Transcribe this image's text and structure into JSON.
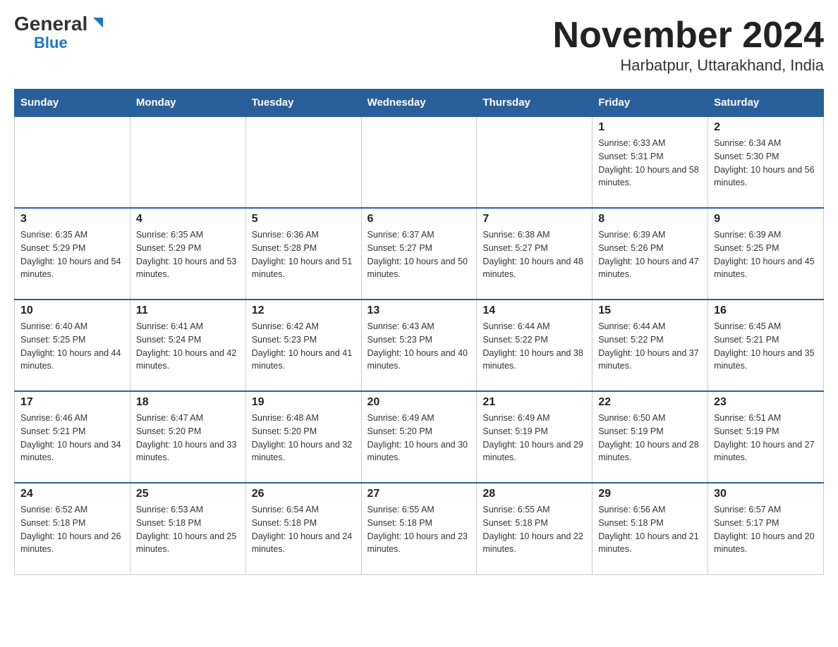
{
  "header": {
    "logo_general": "General",
    "logo_blue": "Blue",
    "month_title": "November 2024",
    "location": "Harbatpur, Uttarakhand, India"
  },
  "days_of_week": [
    "Sunday",
    "Monday",
    "Tuesday",
    "Wednesday",
    "Thursday",
    "Friday",
    "Saturday"
  ],
  "weeks": [
    [
      {
        "day": "",
        "info": ""
      },
      {
        "day": "",
        "info": ""
      },
      {
        "day": "",
        "info": ""
      },
      {
        "day": "",
        "info": ""
      },
      {
        "day": "",
        "info": ""
      },
      {
        "day": "1",
        "info": "Sunrise: 6:33 AM\nSunset: 5:31 PM\nDaylight: 10 hours and 58 minutes."
      },
      {
        "day": "2",
        "info": "Sunrise: 6:34 AM\nSunset: 5:30 PM\nDaylight: 10 hours and 56 minutes."
      }
    ],
    [
      {
        "day": "3",
        "info": "Sunrise: 6:35 AM\nSunset: 5:29 PM\nDaylight: 10 hours and 54 minutes."
      },
      {
        "day": "4",
        "info": "Sunrise: 6:35 AM\nSunset: 5:29 PM\nDaylight: 10 hours and 53 minutes."
      },
      {
        "day": "5",
        "info": "Sunrise: 6:36 AM\nSunset: 5:28 PM\nDaylight: 10 hours and 51 minutes."
      },
      {
        "day": "6",
        "info": "Sunrise: 6:37 AM\nSunset: 5:27 PM\nDaylight: 10 hours and 50 minutes."
      },
      {
        "day": "7",
        "info": "Sunrise: 6:38 AM\nSunset: 5:27 PM\nDaylight: 10 hours and 48 minutes."
      },
      {
        "day": "8",
        "info": "Sunrise: 6:39 AM\nSunset: 5:26 PM\nDaylight: 10 hours and 47 minutes."
      },
      {
        "day": "9",
        "info": "Sunrise: 6:39 AM\nSunset: 5:25 PM\nDaylight: 10 hours and 45 minutes."
      }
    ],
    [
      {
        "day": "10",
        "info": "Sunrise: 6:40 AM\nSunset: 5:25 PM\nDaylight: 10 hours and 44 minutes."
      },
      {
        "day": "11",
        "info": "Sunrise: 6:41 AM\nSunset: 5:24 PM\nDaylight: 10 hours and 42 minutes."
      },
      {
        "day": "12",
        "info": "Sunrise: 6:42 AM\nSunset: 5:23 PM\nDaylight: 10 hours and 41 minutes."
      },
      {
        "day": "13",
        "info": "Sunrise: 6:43 AM\nSunset: 5:23 PM\nDaylight: 10 hours and 40 minutes."
      },
      {
        "day": "14",
        "info": "Sunrise: 6:44 AM\nSunset: 5:22 PM\nDaylight: 10 hours and 38 minutes."
      },
      {
        "day": "15",
        "info": "Sunrise: 6:44 AM\nSunset: 5:22 PM\nDaylight: 10 hours and 37 minutes."
      },
      {
        "day": "16",
        "info": "Sunrise: 6:45 AM\nSunset: 5:21 PM\nDaylight: 10 hours and 35 minutes."
      }
    ],
    [
      {
        "day": "17",
        "info": "Sunrise: 6:46 AM\nSunset: 5:21 PM\nDaylight: 10 hours and 34 minutes."
      },
      {
        "day": "18",
        "info": "Sunrise: 6:47 AM\nSunset: 5:20 PM\nDaylight: 10 hours and 33 minutes."
      },
      {
        "day": "19",
        "info": "Sunrise: 6:48 AM\nSunset: 5:20 PM\nDaylight: 10 hours and 32 minutes."
      },
      {
        "day": "20",
        "info": "Sunrise: 6:49 AM\nSunset: 5:20 PM\nDaylight: 10 hours and 30 minutes."
      },
      {
        "day": "21",
        "info": "Sunrise: 6:49 AM\nSunset: 5:19 PM\nDaylight: 10 hours and 29 minutes."
      },
      {
        "day": "22",
        "info": "Sunrise: 6:50 AM\nSunset: 5:19 PM\nDaylight: 10 hours and 28 minutes."
      },
      {
        "day": "23",
        "info": "Sunrise: 6:51 AM\nSunset: 5:19 PM\nDaylight: 10 hours and 27 minutes."
      }
    ],
    [
      {
        "day": "24",
        "info": "Sunrise: 6:52 AM\nSunset: 5:18 PM\nDaylight: 10 hours and 26 minutes."
      },
      {
        "day": "25",
        "info": "Sunrise: 6:53 AM\nSunset: 5:18 PM\nDaylight: 10 hours and 25 minutes."
      },
      {
        "day": "26",
        "info": "Sunrise: 6:54 AM\nSunset: 5:18 PM\nDaylight: 10 hours and 24 minutes."
      },
      {
        "day": "27",
        "info": "Sunrise: 6:55 AM\nSunset: 5:18 PM\nDaylight: 10 hours and 23 minutes."
      },
      {
        "day": "28",
        "info": "Sunrise: 6:55 AM\nSunset: 5:18 PM\nDaylight: 10 hours and 22 minutes."
      },
      {
        "day": "29",
        "info": "Sunrise: 6:56 AM\nSunset: 5:18 PM\nDaylight: 10 hours and 21 minutes."
      },
      {
        "day": "30",
        "info": "Sunrise: 6:57 AM\nSunset: 5:17 PM\nDaylight: 10 hours and 20 minutes."
      }
    ]
  ]
}
